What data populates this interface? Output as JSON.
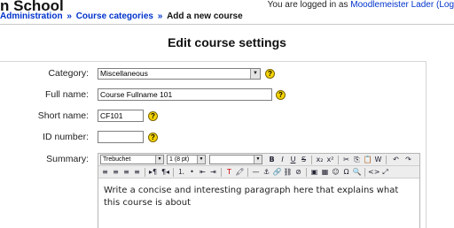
{
  "header": {
    "site_title": "n School",
    "login_prefix": "You are logged in as",
    "user_name": "Moodlemeister Lader",
    "logout_paren": "(Log"
  },
  "breadcrumb": {
    "items": [
      "Administration",
      "Course categories",
      "Add a new course"
    ],
    "separator": "»"
  },
  "page": {
    "heading": "Edit course settings"
  },
  "form": {
    "category": {
      "label": "Category:",
      "value": "Miscellaneous"
    },
    "fullname": {
      "label": "Full name:",
      "value": "Course Fullname 101"
    },
    "shortname": {
      "label": "Short name:",
      "value": "CF101"
    },
    "idnumber": {
      "label": "ID number:",
      "value": ""
    },
    "summary": {
      "label": "Summary:",
      "font_family": "Trebuchet",
      "font_size": "1 (8 pt)",
      "heading_format": "",
      "text": "Write a concise and interesting paragraph here that explains what this course is about"
    },
    "help_glyph": "?"
  },
  "toolbar_icons": {
    "bold": "B",
    "italic": "I",
    "underline": "U",
    "strikethrough": "S",
    "subscript": "x₂",
    "superscript": "x²",
    "cut": "✂",
    "copy": "⎘",
    "paste": "📋",
    "paste_word": "W",
    "undo": "↶",
    "redo": "↷",
    "align_left": "≡",
    "align_center": "≡",
    "align_right": "≡",
    "justify": "≡",
    "ltr": "▸¶",
    "rtl": "¶◂",
    "ordered_list": "⒈",
    "unordered_list": "•",
    "outdent": "⇤",
    "indent": "⇥",
    "text_color": "T",
    "bg_color": "🖍",
    "hr": "—",
    "anchor": "⚓",
    "link": "🔗",
    "unlink": "⛓",
    "nolink": "⊘",
    "image": "▣",
    "table": "▦",
    "smiley": "☺",
    "special_char": "Ω",
    "search": "🔍",
    "html_source": "<>",
    "fullscreen": "⤢"
  },
  "colors": {
    "link": "#0033cc",
    "help": "#f5d400",
    "toolbar_bg": "#ededed"
  }
}
